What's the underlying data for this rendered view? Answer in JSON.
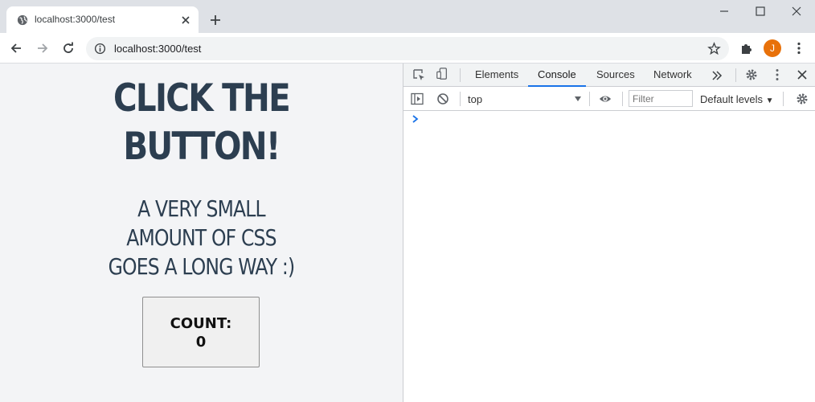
{
  "browser": {
    "tab_title": "localhost:3000/test",
    "url": "localhost:3000/test",
    "avatar_letter": "J",
    "avatar_color": "#e8710a"
  },
  "page": {
    "headline_line1": "CLICK THE",
    "headline_line2": "BUTTON!",
    "subline_line1": "A VERY SMALL",
    "subline_line2": "AMOUNT OF CSS",
    "subline_line3": "GOES A LONG WAY :)",
    "button_label": "COUNT:",
    "button_count": "0",
    "text_color": "#2c3e50",
    "background": "#f3f4f6"
  },
  "devtools": {
    "tabs": [
      "Elements",
      "Console",
      "Sources",
      "Network"
    ],
    "active_tab": "Console",
    "context": "top",
    "filter_placeholder": "Filter",
    "levels": "Default levels",
    "accent": "#1a73e8"
  }
}
